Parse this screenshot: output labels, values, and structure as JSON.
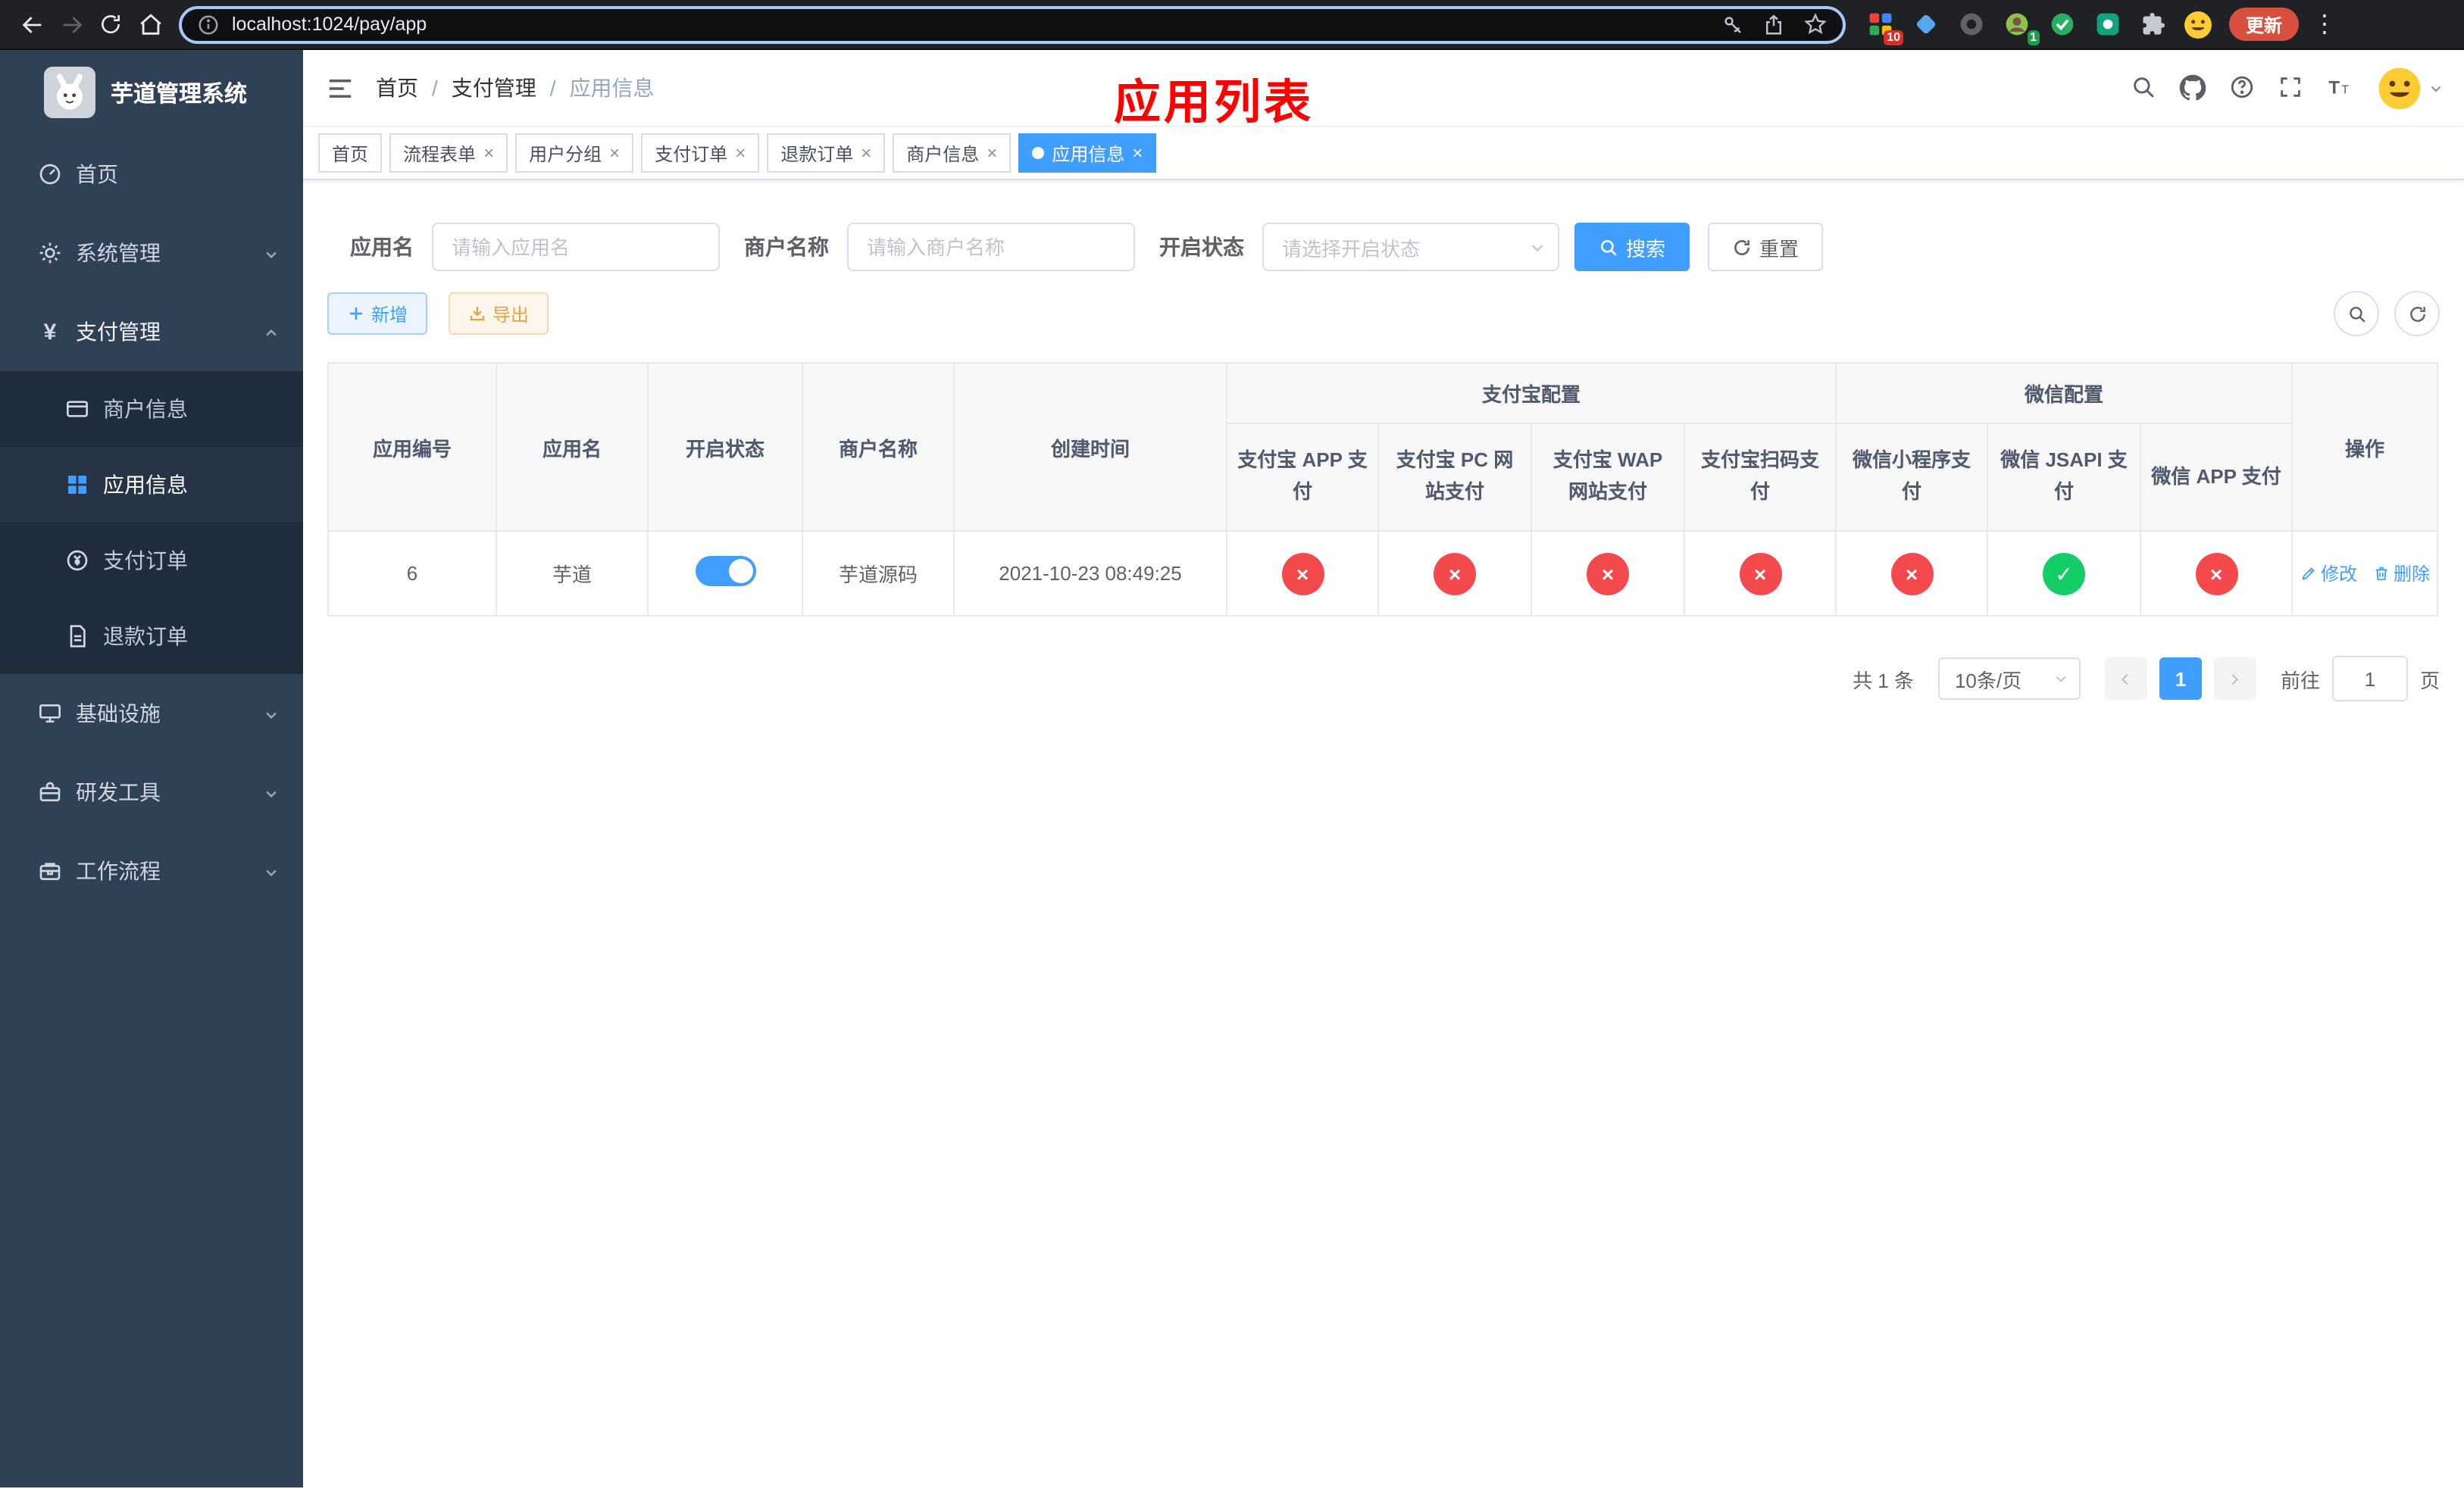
{
  "colors": {
    "accent": "#409eff",
    "success": "#13ce66",
    "danger": "#f4494d",
    "warning": "#e6a23c",
    "overlay_title": "#ff0000",
    "sidebar_bg": "#304156"
  },
  "browser": {
    "url": "localhost:1024/pay/app",
    "update_label": "更新",
    "extensions_badge": "10",
    "profile_badge": "1"
  },
  "sidebar": {
    "title": "芋道管理系统",
    "items": [
      {
        "label": "首页"
      },
      {
        "label": "系统管理"
      },
      {
        "label": "支付管理",
        "children": [
          {
            "label": "商户信息"
          },
          {
            "label": "应用信息"
          },
          {
            "label": "支付订单"
          },
          {
            "label": "退款订单"
          }
        ]
      },
      {
        "label": "基础设施"
      },
      {
        "label": "研发工具"
      },
      {
        "label": "工作流程"
      }
    ]
  },
  "header": {
    "breadcrumb": [
      "首页",
      "支付管理",
      "应用信息"
    ],
    "overlay_title": "应用列表"
  },
  "tabs": [
    {
      "label": "首页"
    },
    {
      "label": "流程表单"
    },
    {
      "label": "用户分组"
    },
    {
      "label": "支付订单"
    },
    {
      "label": "退款订单"
    },
    {
      "label": "商户信息"
    },
    {
      "label": "应用信息"
    }
  ],
  "filters": {
    "app_name_label": "应用名",
    "app_name_placeholder": "请输入应用名",
    "merchant_label": "商户名称",
    "merchant_placeholder": "请输入商户名称",
    "status_label": "开启状态",
    "status_placeholder": "请选择开启状态",
    "search_label": "搜索",
    "reset_label": "重置"
  },
  "toolbar": {
    "add_label": "新增",
    "export_label": "导出"
  },
  "table": {
    "group_headers": {
      "app_id": "应用编号",
      "app_name": "应用名",
      "status": "开启状态",
      "merchant": "商户名称",
      "created": "创建时间",
      "alipay": "支付宝配置",
      "wechat": "微信配置",
      "actions": "操作"
    },
    "sub_headers": [
      "支付宝 APP 支付",
      "支付宝 PC 网站支付",
      "支付宝 WAP 网站支付",
      "支付宝扫码支付",
      "微信小程序支付",
      "微信 JSAPI 支付",
      "微信 APP 支付"
    ],
    "row": {
      "id": "6",
      "name": "芋道",
      "switch_on": true,
      "merchant": "芋道源码",
      "created": "2021-10-23 08:49:25",
      "statuses": [
        false,
        false,
        false,
        false,
        false,
        true,
        false
      ],
      "edit_label": "修改",
      "delete_label": "删除"
    }
  },
  "pagination": {
    "total": "共 1 条",
    "page_size": "10条/页",
    "page": "1",
    "goto_label": "前往",
    "goto_value": "1",
    "page_unit": "页"
  }
}
